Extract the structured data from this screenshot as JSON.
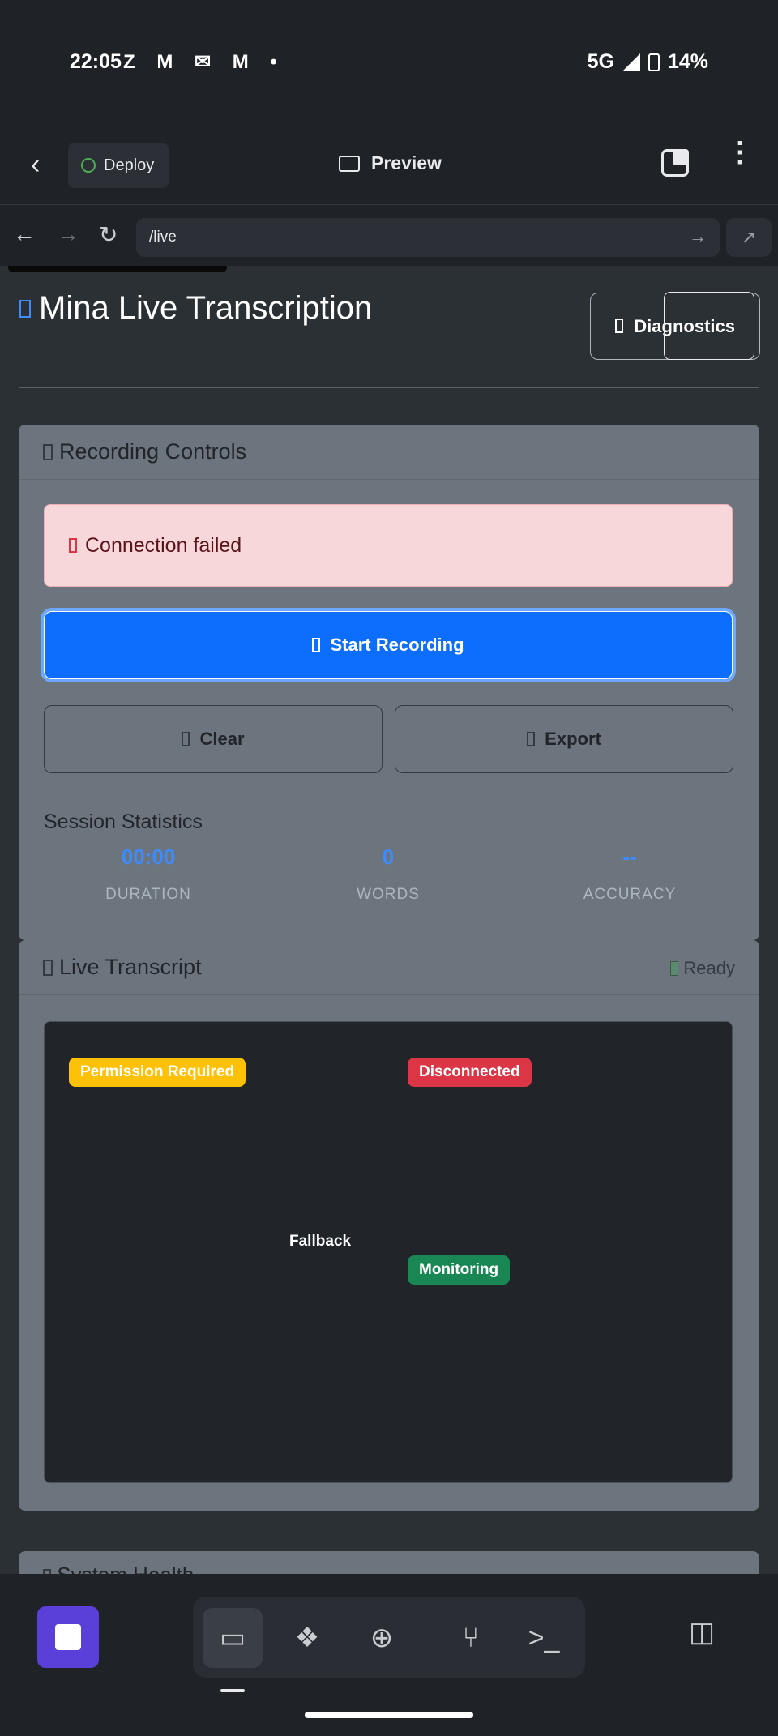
{
  "status_bar": {
    "time": "22:05",
    "notification_icons": "Z M ✉ M •",
    "network": "5G",
    "battery": "14%"
  },
  "app_bar": {
    "deploy_label": "Deploy",
    "preview_label": "Preview"
  },
  "browser": {
    "url": "/live"
  },
  "page": {
    "title": "Mina Live Transcription",
    "diagnostics_label": "Diagnostics"
  },
  "recording_controls": {
    "header": "Recording Controls",
    "alert_text": "Connection failed",
    "start_label": "Start Recording",
    "clear_label": "Clear",
    "export_label": "Export",
    "stats_title": "Session Statistics",
    "stats": [
      {
        "value": "00:00",
        "label": "DURATION"
      },
      {
        "value": "0",
        "label": "WORDS"
      },
      {
        "value": "--",
        "label": "ACCURACY"
      }
    ]
  },
  "live_transcript": {
    "header": "Live Transcript",
    "status": "Ready",
    "badges": {
      "permission": "Permission Required",
      "disconnected": "Disconnected",
      "fallback": "Fallback",
      "monitoring": "Monitoring"
    }
  },
  "system_health": {
    "header": "System Health"
  },
  "colors": {
    "primary": "#0d6efd",
    "danger": "#dc3545",
    "warning": "#ffc107",
    "success": "#198754",
    "card": "#6c757d",
    "stop_button": "#5b3fd9"
  }
}
